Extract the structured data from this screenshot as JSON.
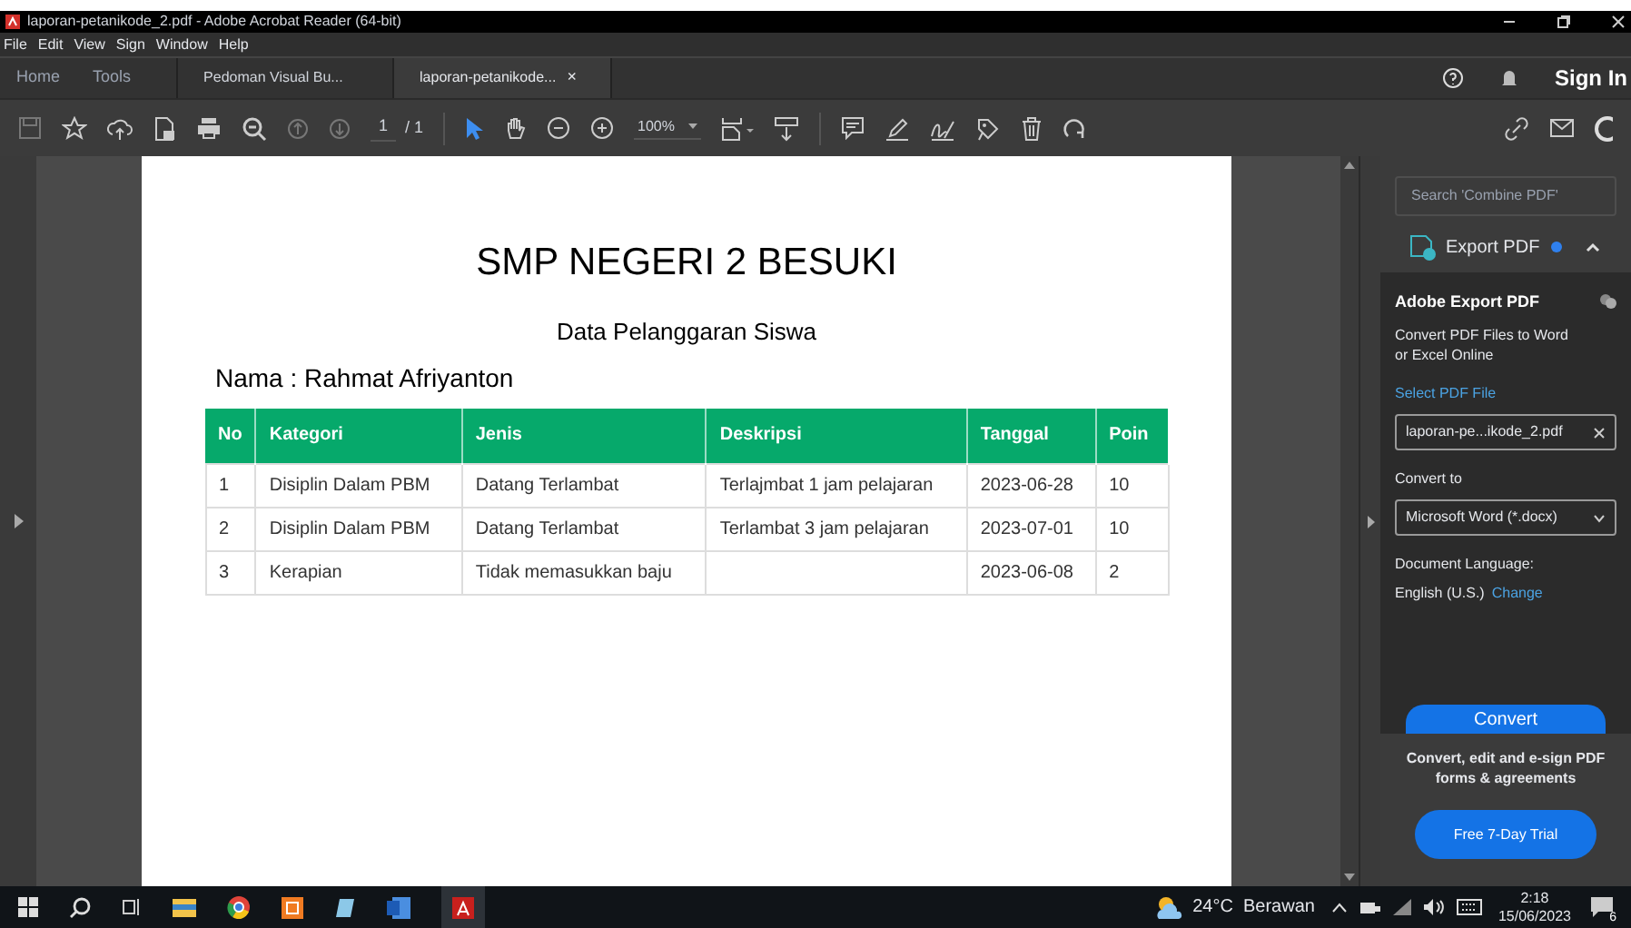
{
  "window": {
    "title": "laporan-petanikode_2.pdf - Adobe Acrobat Reader (64-bit)"
  },
  "menu": [
    "File",
    "Edit",
    "View",
    "Sign",
    "Window",
    "Help"
  ],
  "tabs": [
    {
      "label": "Home",
      "kind": "nav",
      "selected": false
    },
    {
      "label": "Tools",
      "kind": "nav",
      "selected": false
    },
    {
      "label": "Pedoman Visual Bu...",
      "kind": "file",
      "selected": false
    },
    {
      "label": "laporan-petanikode...",
      "kind": "file",
      "selected": true
    }
  ],
  "tab_close": "×",
  "sign_in": "Sign In",
  "toolbar": {
    "page_current": "1",
    "page_total": "/ 1",
    "zoom": "100%"
  },
  "document": {
    "title": "SMP NEGERI 2 BESUKI",
    "subtitle": "Data Pelanggaran Siswa",
    "name_line": "Nama : Rahmat Afriyanton",
    "columns": [
      "No",
      "Kategori",
      "Jenis",
      "Deskripsi",
      "Tanggal",
      "Poin"
    ],
    "rows": [
      [
        "1",
        "Disiplin Dalam PBM",
        "Datang Terlambat",
        "Terlajmbat 1 jam pelajaran",
        "2023-06-28",
        "10"
      ],
      [
        "2",
        "Disiplin Dalam PBM",
        "Datang Terlambat",
        "Terlambat 3 jam pelajaran",
        "2023-07-01",
        "10"
      ],
      [
        "3",
        "Kerapian",
        "Tidak memasukkan baju",
        "",
        "2023-06-08",
        "2"
      ]
    ]
  },
  "right_panel": {
    "search": {
      "placeholder": "Search 'Combine PDF'"
    },
    "tool": {
      "label": "Export PDF",
      "expanded": true
    },
    "heading": "Adobe Export PDF",
    "description": "Convert PDF Files to Word or Excel Online",
    "select_label": "Select PDF File",
    "file": {
      "value": "laporan-pe...ikode_2.pdf"
    },
    "convert_to_label": "Convert to",
    "format": {
      "value": "Microsoft Word (*.docx)"
    },
    "language_label": "Document Language:",
    "language_value": "English (U.S.)",
    "change_link": "Change",
    "convert_button": "Convert",
    "promo": "Convert, edit and e-sign PDF forms & agreements",
    "trial_button": "Free 7-Day Trial"
  },
  "taskbar": {
    "weather": "24°C  Berawan",
    "time": "2:18",
    "date": "15/06/2023",
    "notifications": "6"
  }
}
